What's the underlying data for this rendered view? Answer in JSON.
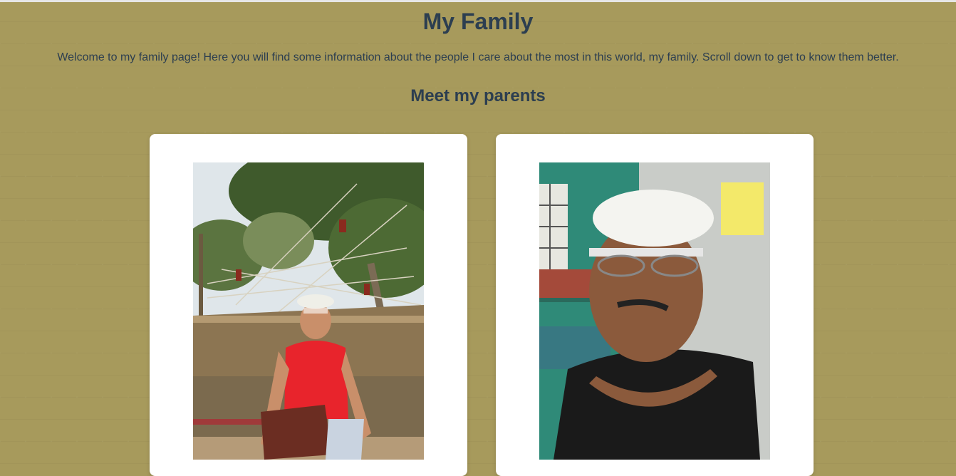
{
  "page": {
    "title": "My Family",
    "intro": "Welcome to my family page! Here you will find some information about the people I care about the most in this world, my family. Scroll down to get to know them better.",
    "section_heading": "Meet my parents"
  },
  "colors": {
    "background": "#a79a5c",
    "heading": "#2c3e50",
    "card": "#ffffff"
  },
  "parents": [
    {
      "photo": "mother-photo"
    },
    {
      "photo": "father-photo"
    }
  ]
}
